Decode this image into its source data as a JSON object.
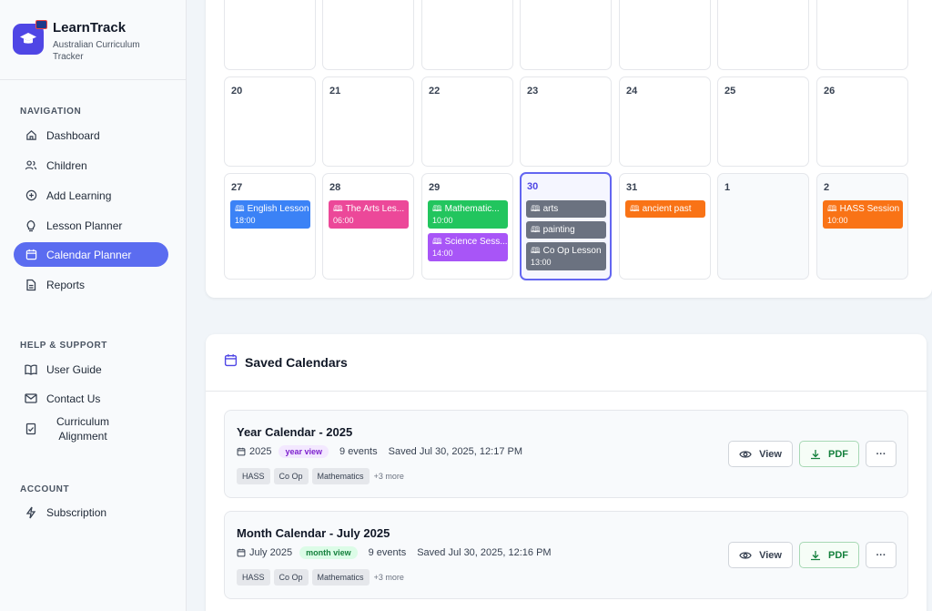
{
  "brand": {
    "title": "LearnTrack",
    "subtitle": "Australian Curriculum Tracker"
  },
  "sidebar": {
    "navigation_label": "NAVIGATION",
    "navigation": [
      {
        "label": "Dashboard",
        "icon": "home-icon"
      },
      {
        "label": "Children",
        "icon": "users-icon"
      },
      {
        "label": "Add Learning",
        "icon": "plus-circle-icon"
      },
      {
        "label": "Lesson Planner",
        "icon": "lightbulb-icon"
      },
      {
        "label": "Calendar Planner",
        "icon": "calendar-icon",
        "active": true
      },
      {
        "label": "Reports",
        "icon": "file-icon"
      }
    ],
    "help_label": "HELP & SUPPORT",
    "help": [
      {
        "label": "User Guide",
        "icon": "book-icon"
      },
      {
        "label": "Contact Us",
        "icon": "mail-icon"
      },
      {
        "label": "Curriculum Alignment",
        "icon": "checklist-icon"
      }
    ],
    "account_label": "ACCOUNT",
    "account": [
      {
        "label": "Subscription",
        "icon": "bolt-icon"
      }
    ]
  },
  "calendar": {
    "row2_days": [
      "20",
      "21",
      "22",
      "23",
      "24",
      "25",
      "26"
    ],
    "row3": [
      {
        "day": "27",
        "events": [
          {
            "title": "English Lesson",
            "time": "18:00",
            "color": "#3b82f6"
          }
        ]
      },
      {
        "day": "28",
        "events": [
          {
            "title": "The Arts Les...",
            "time": "06:00",
            "color": "#ec4899"
          }
        ]
      },
      {
        "day": "29",
        "events": [
          {
            "title": "Mathematic...",
            "time": "10:00",
            "color": "#22c55e"
          },
          {
            "title": "Science Sess...",
            "time": "14:00",
            "color": "#a855f7"
          }
        ]
      },
      {
        "day": "30",
        "today": true,
        "events": [
          {
            "title": "arts",
            "time": "",
            "color": "#6b7280"
          },
          {
            "title": "painting",
            "time": "",
            "color": "#6b7280"
          },
          {
            "title": "Co Op Lesson",
            "time": "13:00",
            "color": "#6b7280"
          }
        ]
      },
      {
        "day": "31",
        "events": [
          {
            "title": "ancient past",
            "time": "",
            "color": "#f97316"
          }
        ]
      },
      {
        "day": "1",
        "other": true,
        "events": []
      },
      {
        "day": "2",
        "other": true,
        "events": [
          {
            "title": "HASS Session",
            "time": "10:00",
            "color": "#f97316"
          }
        ]
      }
    ]
  },
  "saved": {
    "title": "Saved Calendars",
    "items": [
      {
        "title": "Year Calendar - 2025",
        "period": "2025",
        "view": "year view",
        "view_bg": "#f3e8ff",
        "view_color": "#7e22ce",
        "events": "9 events",
        "saved": "Saved Jul 30, 2025, 12:17 PM",
        "tags": [
          "HASS",
          "Co Op",
          "Mathematics"
        ],
        "more": "+3 more"
      },
      {
        "title": "Month Calendar - July 2025",
        "period": "July 2025",
        "view": "month view",
        "view_bg": "#dcfce7",
        "view_color": "#15803d",
        "events": "9 events",
        "saved": "Saved Jul 30, 2025, 12:16 PM",
        "tags": [
          "HASS",
          "Co Op",
          "Mathematics"
        ],
        "more": "+3 more"
      }
    ],
    "view_label": "View",
    "pdf_label": "PDF",
    "menu_label": "···"
  }
}
